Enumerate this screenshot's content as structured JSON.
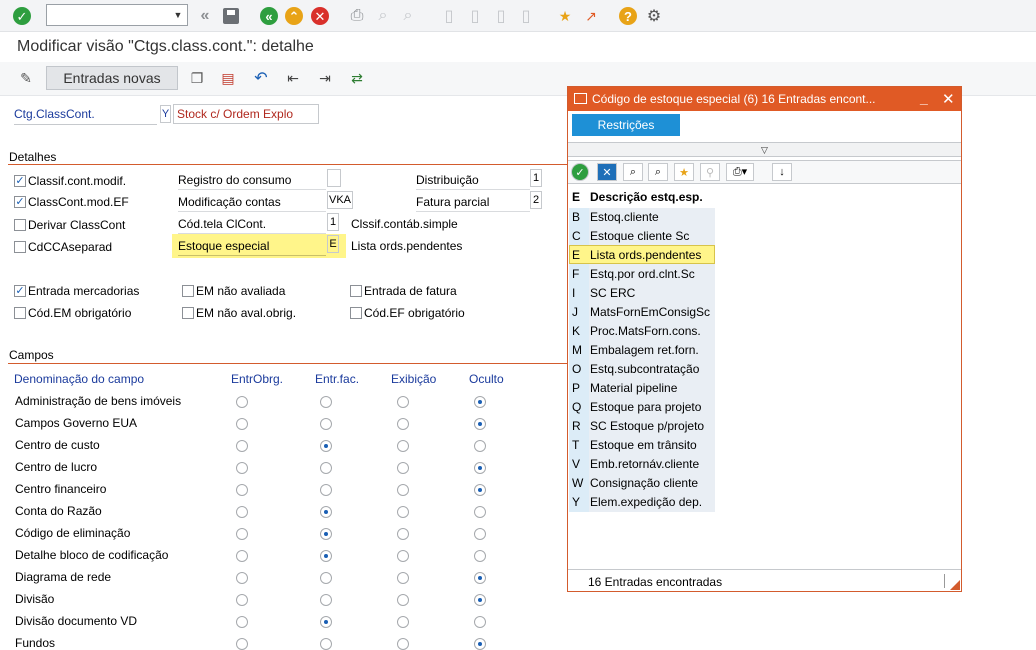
{
  "toolbar": {
    "command_field_value": "",
    "icons": [
      "check-icon",
      "back-double-icon",
      "save-icon",
      "back-icon",
      "exit-icon",
      "cancel-icon",
      "print-icon",
      "find-icon",
      "find-next-icon",
      "first-page-icon",
      "prev-page-icon",
      "next-page-icon",
      "last-page-icon",
      "new-session-icon",
      "shortcut-icon",
      "help-icon",
      "settings-icon"
    ]
  },
  "title": "Modificar visão \"Ctgs.class.cont.\": detalhe",
  "appbar": {
    "new_entries_label": "Entradas novas"
  },
  "header_field": {
    "label": "Ctg.ClassCont.",
    "key": "Y",
    "value": "Stock c/ Ordem Explo"
  },
  "details": {
    "title": "Detalhes",
    "checkboxes": [
      {
        "label": "Classif.cont.modif.",
        "checked": true
      },
      {
        "label": "ClassCont.mod.EF",
        "checked": true
      },
      {
        "label": "Derivar ClassCont",
        "checked": false
      },
      {
        "label": "CdCCAseparad",
        "checked": false
      }
    ],
    "mid_fields": [
      {
        "label": "Registro do consumo",
        "value": ""
      },
      {
        "label": "Modificação contas",
        "value": "VKA"
      },
      {
        "label": "Cód.tela ClCont.",
        "value": "1",
        "text": "Clssif.contáb.simple"
      },
      {
        "label": "Estoque especial",
        "value": "E",
        "text": "Lista ords.pendentes"
      }
    ],
    "right_fields": [
      {
        "label": "Distribuição",
        "value": "1"
      },
      {
        "label": "Fatura parcial",
        "value": "2"
      }
    ],
    "checkboxes2": [
      {
        "label": "Entrada mercadorias",
        "checked": true
      },
      {
        "label": "Cód.EM obrigatório",
        "checked": false
      },
      {
        "label": "EM não avaliada",
        "checked": false
      },
      {
        "label": "EM não aval.obrig.",
        "checked": false
      },
      {
        "label": "Entrada de fatura",
        "checked": false
      },
      {
        "label": "Cód.EF obrigatório",
        "checked": false
      }
    ]
  },
  "fields": {
    "title": "Campos",
    "headers": [
      "Denominação do campo",
      "EntrObrg.",
      "Entr.fac.",
      "Exibição",
      "Oculto"
    ],
    "rows": [
      {
        "name": "Administração de bens imóveis",
        "selected": 3
      },
      {
        "name": "Campos Governo EUA",
        "selected": 3
      },
      {
        "name": "Centro de custo",
        "selected": 1
      },
      {
        "name": "Centro de lucro",
        "selected": 3
      },
      {
        "name": "Centro financeiro",
        "selected": 3
      },
      {
        "name": "Conta do Razão",
        "selected": 1
      },
      {
        "name": "Código de eliminação",
        "selected": 1
      },
      {
        "name": "Detalhe bloco de codificação",
        "selected": 1
      },
      {
        "name": "Diagrama de rede",
        "selected": 3
      },
      {
        "name": "Divisão",
        "selected": 3
      },
      {
        "name": "Divisão documento VD",
        "selected": 1
      },
      {
        "name": "Fundos",
        "selected": 3
      }
    ]
  },
  "popup": {
    "title": "Código de estoque especial (6)   16 Entradas encont...",
    "tab": "Restrições",
    "columns": [
      "E",
      "Descrição estq.esp."
    ],
    "items": [
      {
        "key": "B",
        "desc": "Estoq.cliente"
      },
      {
        "key": "C",
        "desc": "Estoque cliente Sc"
      },
      {
        "key": "E",
        "desc": "Lista ords.pendentes"
      },
      {
        "key": "F",
        "desc": "Estq.por ord.clnt.Sc"
      },
      {
        "key": "I",
        "desc": "SC ERC"
      },
      {
        "key": "J",
        "desc": "MatsFornEmConsigSc"
      },
      {
        "key": "K",
        "desc": "Proc.MatsForn.cons."
      },
      {
        "key": "M",
        "desc": "Embalagem ret.forn."
      },
      {
        "key": "O",
        "desc": "Estq.subcontratação"
      },
      {
        "key": "P",
        "desc": "Material pipeline"
      },
      {
        "key": "Q",
        "desc": "Estoque para projeto"
      },
      {
        "key": "R",
        "desc": "SC Estoque p/projeto"
      },
      {
        "key": "T",
        "desc": "Estoque em trânsito"
      },
      {
        "key": "V",
        "desc": "Emb.retornáv.cliente"
      },
      {
        "key": "W",
        "desc": "Consignação cliente"
      },
      {
        "key": "Y",
        "desc": "Elem.expedição dep."
      }
    ],
    "selected_key": "E",
    "status": "16 Entradas encontradas"
  },
  "colors": {
    "accent": "#d35b2d",
    "popup_title": "#e05a25",
    "tab": "#1e90d6",
    "highlight": "#fff58a",
    "link_blue": "#1a3a9c",
    "list_key_bg": "#dcecf7",
    "list_row_bg": "#e9eef4"
  }
}
